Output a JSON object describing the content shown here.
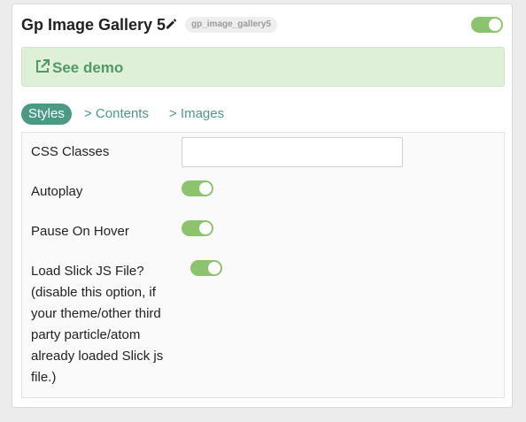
{
  "header": {
    "title": "Gp Image Gallery 5",
    "id_badge": "gp_image_gallery5",
    "enabled": true
  },
  "demo": {
    "link_label": "See demo"
  },
  "tabs": [
    {
      "label": "Styles",
      "active": true
    },
    {
      "label": "> Contents",
      "active": false
    },
    {
      "label": "> Images",
      "active": false
    }
  ],
  "settings": {
    "css_classes": {
      "label": "CSS Classes",
      "value": ""
    },
    "autoplay": {
      "label": "Autoplay",
      "enabled": true
    },
    "pause_on_hover": {
      "label": "Pause On Hover",
      "enabled": true
    },
    "load_slick": {
      "label_lines": [
        "Load Slick JS File?",
        "(disable this option, if",
        "your theme/other third",
        "party particle/atom",
        "already loaded Slick js",
        "file.)"
      ],
      "enabled": true
    }
  },
  "colors": {
    "toggle_on": "#8cc46e",
    "demo_bg": "#def0d8",
    "demo_text": "#4f9a64",
    "tab_active_bg": "#4a9a86",
    "tab_text": "#4a9a8c"
  },
  "icons": {
    "edit": "pencil-icon",
    "demo": "external-link-icon"
  }
}
